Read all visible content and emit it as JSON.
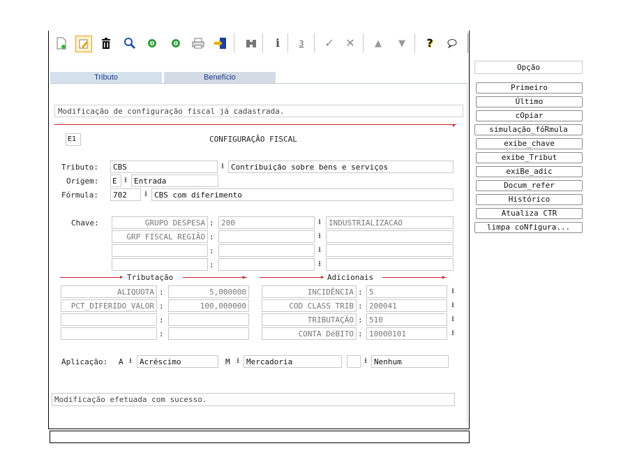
{
  "toolbar": {
    "icons": [
      "new-document-icon",
      "edit-icon",
      "trash-icon",
      "search-icon",
      "previous-record-icon",
      "next-record-icon",
      "print-icon",
      "exit-icon",
      "binoculars-icon",
      "info-icon",
      "numbered-info-icon",
      "confirm-icon",
      "cancel-icon",
      "arrow-up-icon",
      "arrow-down-icon",
      "help-icon",
      "chat-icon"
    ]
  },
  "tabs": [
    {
      "label": "Tributo"
    },
    {
      "label": "Benefício"
    }
  ],
  "header": {
    "message": "Modificação de configuração fiscal já cadastrada.",
    "code": "E1",
    "title": "CONFIGURAÇÃO FISCAL"
  },
  "form": {
    "tributo": {
      "label": "Tributo:",
      "code": "CBS",
      "description": "Contribuição sobre bens e serviços"
    },
    "origem": {
      "label": "Origem:",
      "code": "E",
      "description": "Entrada"
    },
    "formula": {
      "label": "Fórmula:",
      "code": "702",
      "description": "CBS com diferimento"
    },
    "chave": {
      "label": "Chave:",
      "rows": [
        {
          "name": "GRUPO DESPESA",
          "sep": ":",
          "value": "200",
          "description": "INDUSTRIALIZACAO"
        },
        {
          "name": "GRP FISCAL REGIÃO",
          "sep": ":",
          "value": "",
          "description": ""
        },
        {
          "name": "",
          "sep": ":",
          "value": "",
          "description": ""
        },
        {
          "name": "",
          "sep": ":",
          "value": "",
          "description": ""
        }
      ]
    },
    "tributacao": {
      "title": "Tributação",
      "rows": [
        {
          "name": "ALIQUOTA",
          "sep": ":",
          "value": "5,000000"
        },
        {
          "name": "PCT_DIFERIDO_VALOR",
          "sep": ":",
          "value": "100,000000"
        },
        {
          "name": "",
          "sep": ":",
          "value": ""
        },
        {
          "name": "",
          "sep": ":",
          "value": ""
        }
      ]
    },
    "adicionais": {
      "title": "Adicionais",
      "rows": [
        {
          "name": "INCIDÊNCIA",
          "sep": ":",
          "value": "5"
        },
        {
          "name": "COD CLASS TRIB",
          "sep": ":",
          "value": "200041"
        },
        {
          "name": "TRIBUTAÇÃO",
          "sep": ":",
          "value": "510"
        },
        {
          "name": "CONTA DéBITO",
          "sep": ":",
          "value": "10000101"
        }
      ]
    },
    "aplicacao": {
      "label": "Aplicação:",
      "field1": {
        "code": "A",
        "description": "Acréscimo"
      },
      "field2": {
        "code": "M",
        "description": "Mercadoria"
      },
      "field3": {
        "code": "",
        "description": "Nenhum"
      }
    }
  },
  "status": {
    "message": "Modificação efetuada com sucesso."
  },
  "options": {
    "title": "Opção",
    "buttons": [
      "Primeiro",
      "Último",
      "cOpiar",
      "simulação_fóRmula",
      "exibe_chave",
      "exibe_Tribut",
      "exiBe_adic",
      "Docum_refer",
      "Histórico",
      "Atualiza CTR",
      "limpa coNfigura..."
    ]
  },
  "colors": {
    "accent_red": "#c8202a",
    "tab_active": "#d4e0ec",
    "tab_text": "#1c3c8c"
  }
}
